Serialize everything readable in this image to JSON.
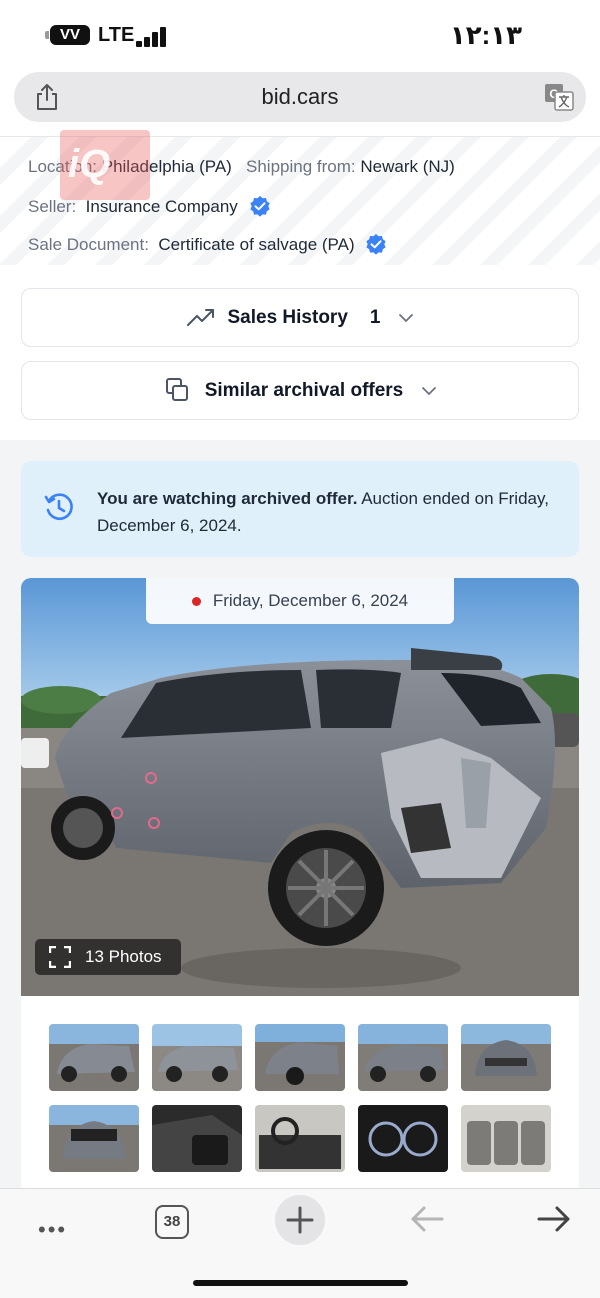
{
  "status_bar": {
    "battery_label": "VV",
    "network": "LTE",
    "time": "١٢:١٣"
  },
  "browser": {
    "url": "bid.cars",
    "share_icon": "share-icon",
    "translate_icon": "translate-icon"
  },
  "listing": {
    "location_label": "Location:",
    "location_value": "Philadelphia (PA)",
    "shipping_label": "Shipping from:",
    "shipping_value": "Newark (NJ)",
    "seller_label": "Seller:",
    "seller_value": "Insurance Company",
    "document_label": "Sale Document:",
    "document_value": "Certificate of salvage (PA)",
    "watermark_text": "iQ"
  },
  "sales_history": {
    "label": "Sales History",
    "count": "1"
  },
  "similar_offers": {
    "label": "Similar archival offers"
  },
  "notice": {
    "bold_text": "You are watching archived offer.",
    "text": " Auction ended on Friday, December 6, 2024."
  },
  "gallery": {
    "date": "Friday, December 6, 2024",
    "photos_label": "13 Photos",
    "thumbnails": [
      "rear-left view",
      "side view",
      "rear view",
      "front view",
      "front",
      "rear",
      "interior seats",
      "dashboard",
      "instrument cluster",
      "rear seats"
    ]
  },
  "toolbar": {
    "tabs_count": "38",
    "more_label": "•••"
  },
  "colors": {
    "accent_blue": "#3b82f6",
    "notice_bg": "#e0f0fb",
    "red_dot": "#dc2626"
  }
}
